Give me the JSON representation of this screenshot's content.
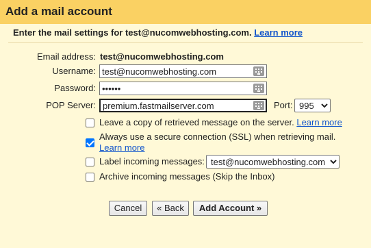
{
  "dialog": {
    "title": "Add a mail account",
    "intro_text": "Enter the mail settings for test@nucomwebhosting.com.",
    "intro_link": "Learn more"
  },
  "form": {
    "email_label": "Email address:",
    "email_value": "test@nucomwebhosting.com",
    "username_label": "Username:",
    "username_value": "test@nucomwebhosting.com",
    "password_label": "Password:",
    "password_value": "••••••",
    "pop_label": "POP Server:",
    "pop_value": "premium.fastmailserver.com",
    "port_label": "Port:",
    "port_value": "995"
  },
  "options": [
    {
      "label": "Leave a copy of retrieved message on the server.",
      "link": "Learn more",
      "checked": false
    },
    {
      "label": "Always use a secure connection (SSL) when retrieving mail.",
      "link": "Learn more",
      "checked": true
    },
    {
      "label": "Label incoming messages:",
      "select_value": "test@nucomwebhosting.com",
      "checked": false
    },
    {
      "label": "Archive incoming messages (Skip the Inbox)",
      "checked": false
    }
  ],
  "buttons": {
    "cancel": "Cancel",
    "back": "« Back",
    "add": "Add Account »"
  }
}
